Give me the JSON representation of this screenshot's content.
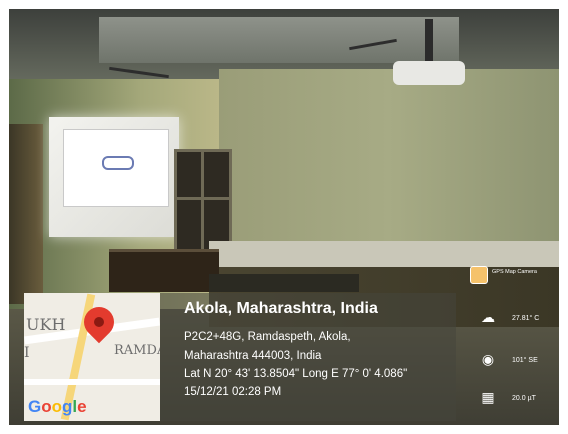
{
  "overlay": {
    "place_title": "Akola, Maharashtra, India",
    "address_line1": "P2C2+48G, Ramdaspeth, Akola,",
    "address_line2": "Maharashtra 444003, India",
    "coords": "Lat N 20° 43' 13.8504\" Long E 77° 0' 4.086\"",
    "datetime": "15/12/21 02:28 PM"
  },
  "map": {
    "label_a": "UKH",
    "label_b": "I",
    "label_c": "RAMDAS",
    "brand_g": "G",
    "brand_o1": "o",
    "brand_o2": "o",
    "brand_g2": "g",
    "brand_l": "l",
    "brand_e": "e"
  },
  "side": {
    "app_name": "GPS Map Camera",
    "temperature": "27.81° C",
    "direction": "101° SE",
    "magnetic": "20.0 µT"
  },
  "icons": {
    "app": "gps-map-camera-icon",
    "weather": "weather-icon",
    "compass": "compass-icon",
    "magnet": "magnetic-field-icon",
    "pin": "map-pin-icon"
  }
}
